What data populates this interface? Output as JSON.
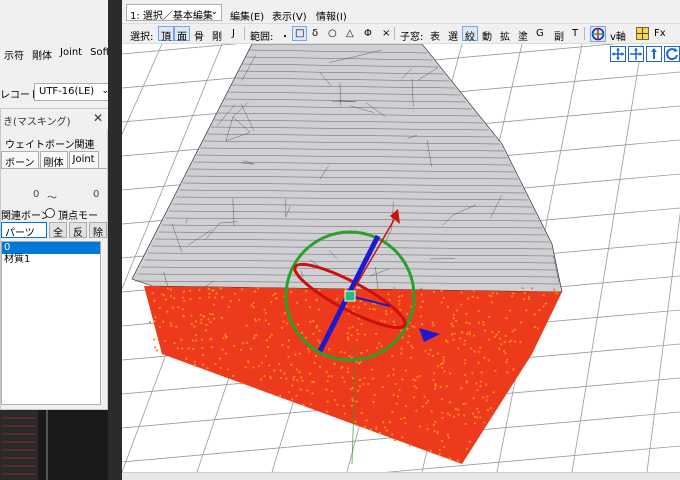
{
  "left_panel": {
    "tabs": [
      "示符",
      "剛体",
      "Joint",
      "SoftBod"
    ],
    "encoding_label": "レコード:",
    "encoding_value": "UTF-16(LE)",
    "mask_title": "き(マスキング)",
    "weight_button": "ウェイトボーン関連(B)",
    "mask_tabs": [
      "ボーン",
      "剛体",
      "Joint"
    ],
    "range": {
      "from": "0",
      "sep": "〜",
      "to": "0"
    },
    "related_bone_label": "関連ボーン",
    "vertex_morph_label": "頂点モーフ",
    "buttons": [
      "パーツ毎",
      "全",
      "反",
      "除"
    ],
    "material_list": [
      "材質1"
    ]
  },
  "main": {
    "mode_select": "1: 選択／基本編集",
    "menus": [
      "編集(E)",
      "表示(V)",
      "情報(I)"
    ],
    "toolbar": {
      "select_label": "選択:",
      "select_items": [
        "頂",
        "面",
        "骨",
        "剛",
        "J"
      ],
      "range_label": "範囲:",
      "range_items": [
        "・",
        "□",
        "δ",
        "○",
        "△",
        "Φ",
        "×"
      ],
      "kana_label": "子窓:",
      "kana_items": [
        "表",
        "選",
        "絞",
        "動",
        "拡",
        "塗",
        "G",
        "副",
        "T"
      ],
      "axis_label": "v軸",
      "fx_label": "Fx"
    }
  },
  "colors": {
    "mesh_fill": "#d0d0d4",
    "mesh_line": "#1a1a1a",
    "particle_red": "#ee3a1c",
    "particle_orange": "#ff8a1a",
    "gizmo_green": "#2aa02a",
    "gizmo_blue": "#1a1ad0",
    "gizmo_red": "#cc1010",
    "grid": "#9a9a9a",
    "select_highlight": "#0078d7"
  },
  "icons": [
    "move-icon",
    "move-xyz-icon",
    "rotate-handle-icon",
    "rotate-icon",
    "axis-toggle-icon",
    "fx-icon",
    "chevron-down-icon",
    "close-icon"
  ]
}
